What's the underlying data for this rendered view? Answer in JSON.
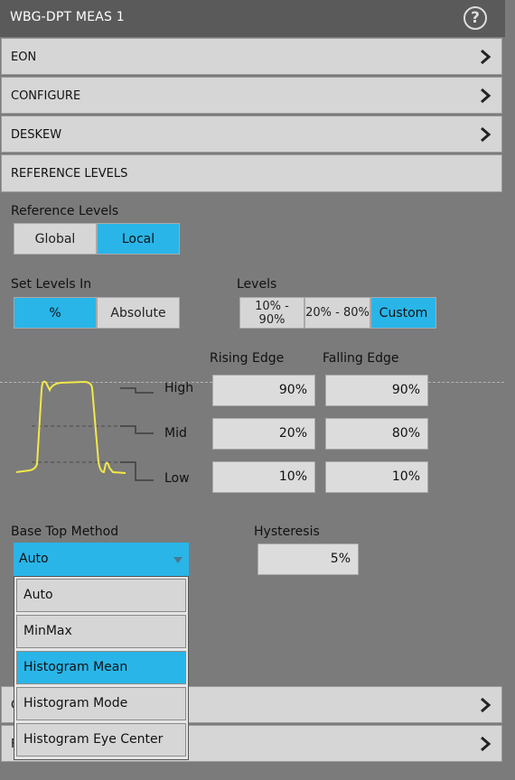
{
  "title": "WBG-DPT MEAS 1",
  "help_icon": "help-circle-icon",
  "sections": [
    {
      "label": "EON"
    },
    {
      "label": "CONFIGURE"
    },
    {
      "label": "DESKEW"
    },
    {
      "label": "REFERENCE LEVELS"
    }
  ],
  "bottom_sections": [
    {
      "label": "C"
    },
    {
      "label": "F"
    }
  ],
  "reference_levels": {
    "label": "Reference Levels",
    "options": [
      "Global",
      "Local"
    ],
    "selected": "Local"
  },
  "set_levels_in": {
    "label": "Set Levels In",
    "options": [
      "%",
      "Absolute"
    ],
    "selected": "%"
  },
  "levels": {
    "label": "Levels",
    "options": [
      "10% - 90%",
      "20% - 80%",
      "Custom"
    ],
    "selected": "Custom"
  },
  "table": {
    "rising_header": "Rising Edge",
    "falling_header": "Falling Edge",
    "rows": [
      {
        "label": "High",
        "rising": "90%",
        "falling": "90%"
      },
      {
        "label": "Mid",
        "rising": "20%",
        "falling": "80%"
      },
      {
        "label": "Low",
        "rising": "10%",
        "falling": "10%"
      }
    ]
  },
  "base_top_method": {
    "label": "Base Top Method",
    "value": "Auto",
    "options": [
      "Auto",
      "MinMax",
      "Histogram Mean",
      "Histogram Mode",
      "Histogram Eye Center"
    ],
    "highlighted": "Histogram Mean"
  },
  "hysteresis": {
    "label": "Hysteresis",
    "value": "5%"
  },
  "colors": {
    "accent": "#29b5e8",
    "waveform": "#f2e84a",
    "panel": "#7b7b7b"
  }
}
